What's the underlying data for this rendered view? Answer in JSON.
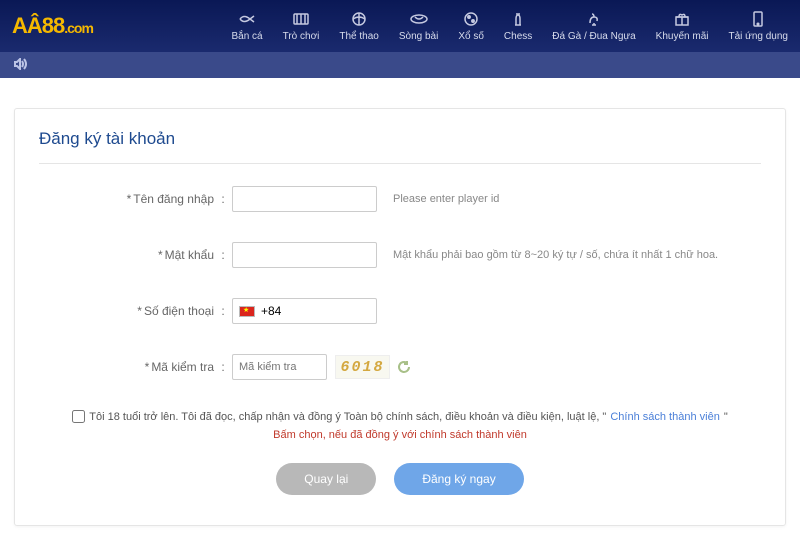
{
  "logo": {
    "brand": "AÂ88",
    "suffix": ".com"
  },
  "nav": {
    "items": [
      {
        "label": "Bắn cá"
      },
      {
        "label": "Trò chơi"
      },
      {
        "label": "Thể thao"
      },
      {
        "label": "Sòng bài"
      },
      {
        "label": "Xổ số"
      },
      {
        "label": "Chess"
      },
      {
        "label": "Đá Gà / Đua Ngựa"
      },
      {
        "label": "Khuyến mãi"
      },
      {
        "label": "Tải ứng dụng"
      }
    ]
  },
  "form": {
    "title": "Đăng ký tài khoản",
    "username": {
      "label": "Tên đăng nhập",
      "hint": "Please enter player id"
    },
    "password": {
      "label": "Mật khẩu",
      "hint": "Mật khẩu phải bao gồm từ 8~20 ký tự / số, chứa ít nhất 1 chữ hoa."
    },
    "phone": {
      "label": "Số điện thoại",
      "code": "+84"
    },
    "captcha": {
      "label": "Mã kiểm tra",
      "placeholder": "Mã kiểm tra",
      "value": "6018"
    },
    "terms": {
      "text": "Tôi 18 tuổi trở lên. Tôi đã đọc, chấp nhận và đồng ý Toàn bộ chính sách, điều khoản và điều kiện, luật lệ, \"",
      "link": "Chính sách thành viên",
      "after": "\""
    },
    "warn": "Bấm chọn, nếu đã đồng ý với chính sách thành viên",
    "buttons": {
      "back": "Quay lại",
      "submit": "Đăng ký ngay"
    }
  }
}
